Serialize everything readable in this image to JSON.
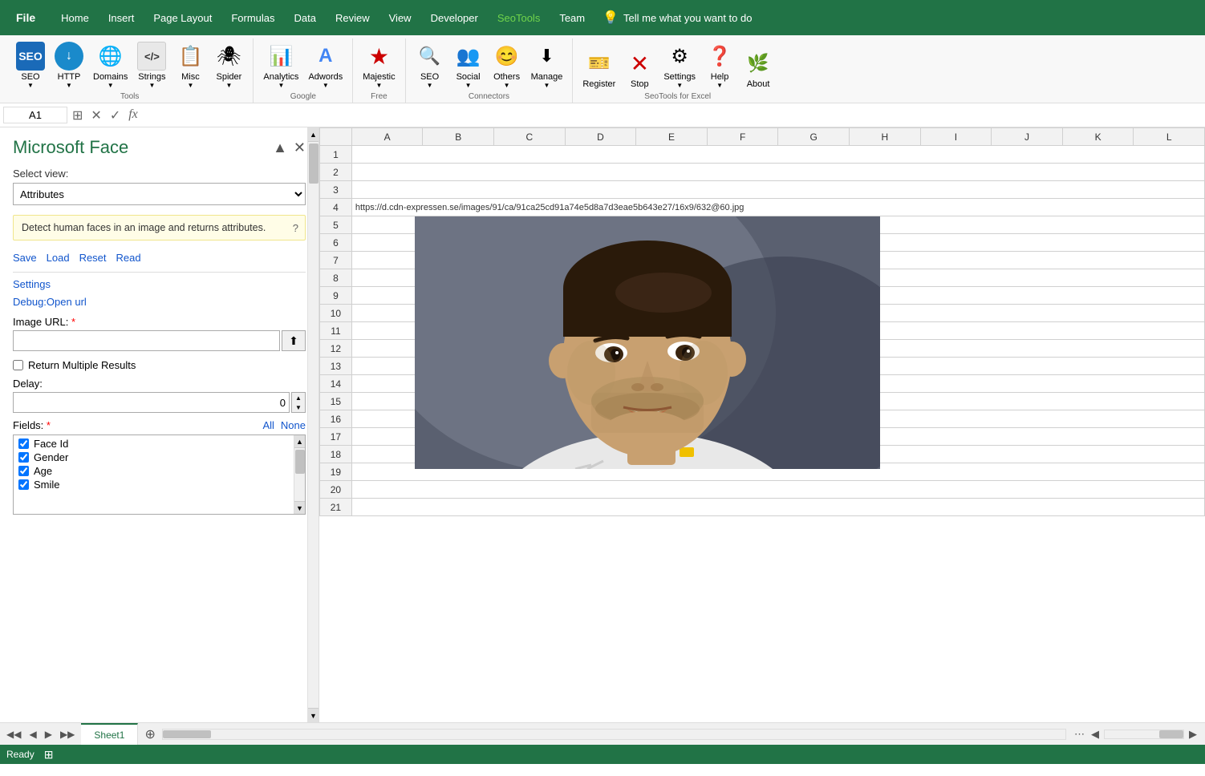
{
  "menubar": {
    "file": "File",
    "items": [
      "Home",
      "Insert",
      "Page Layout",
      "Formulas",
      "Data",
      "Review",
      "View",
      "Developer",
      "SeoTools",
      "Team"
    ],
    "tell": "Tell me what you want to do"
  },
  "ribbon": {
    "groups": {
      "tools": {
        "label": "Tools",
        "items": [
          {
            "id": "seo",
            "icon": "🔍",
            "label": "SEO"
          },
          {
            "id": "http",
            "icon": "↓",
            "label": "HTTP"
          },
          {
            "id": "domains",
            "icon": "🌐",
            "label": "Domains"
          },
          {
            "id": "strings",
            "icon": "</>",
            "label": "Strings"
          },
          {
            "id": "misc",
            "icon": "📋",
            "label": "Misc"
          },
          {
            "id": "spider",
            "icon": "🕷",
            "label": "Spider"
          }
        ]
      },
      "google": {
        "label": "Google",
        "items": [
          {
            "id": "analytics",
            "icon": "📈",
            "label": "Analytics"
          },
          {
            "id": "adwords",
            "icon": "A",
            "label": "Adwords"
          }
        ]
      },
      "free": {
        "label": "Free",
        "items": [
          {
            "id": "majestic",
            "icon": "★",
            "label": "Majestic"
          }
        ]
      },
      "connectors": {
        "label": "Connectors",
        "items": [
          {
            "id": "seo2",
            "icon": "🔍",
            "label": "SEO"
          },
          {
            "id": "social",
            "icon": "👥",
            "label": "Social"
          },
          {
            "id": "others",
            "icon": "😊",
            "label": "Others"
          },
          {
            "id": "manage",
            "icon": "↓",
            "label": "Manage"
          }
        ]
      },
      "seotools": {
        "label": "SeoTools for Excel",
        "items": [
          {
            "id": "register",
            "icon": "🎫",
            "label": "Register"
          },
          {
            "id": "stop",
            "icon": "✖",
            "label": "Stop"
          },
          {
            "id": "settings",
            "icon": "⚙",
            "label": "Settings"
          },
          {
            "id": "help",
            "icon": "❓",
            "label": "Help"
          },
          {
            "id": "about",
            "icon": "🔰",
            "label": "About"
          }
        ]
      }
    }
  },
  "formulabar": {
    "cellref": "A1",
    "value": ""
  },
  "sidebar": {
    "title": "Microsoft Face",
    "select_view_label": "Select view:",
    "select_view_value": "Attributes",
    "info_text": "Detect human faces in an image and returns attributes.",
    "links": {
      "save": "Save",
      "load": "Load",
      "reset": "Reset",
      "read": "Read"
    },
    "settings_link": "Settings",
    "debug_link": "Debug:Open url",
    "image_url_label": "Image URL:",
    "image_url_placeholder": "",
    "return_multiple": "Return Multiple Results",
    "delay_label": "Delay:",
    "delay_value": "0",
    "fields_label": "Fields:",
    "fields_all": "All",
    "fields_none": "None",
    "fields": [
      {
        "name": "Face Id",
        "checked": true
      },
      {
        "name": "Gender",
        "checked": true
      },
      {
        "name": "Age",
        "checked": true
      },
      {
        "name": "Smile",
        "checked": true
      }
    ]
  },
  "spreadsheet": {
    "columns": [
      "A",
      "B",
      "C",
      "D",
      "E",
      "F",
      "G",
      "H",
      "I",
      "J",
      "K",
      "L"
    ],
    "rows": [
      1,
      2,
      3,
      4,
      5,
      6,
      7,
      8,
      9,
      10,
      11,
      12,
      13,
      14,
      15,
      16,
      17,
      18,
      19,
      20,
      21
    ],
    "url_cell": {
      "row": 4,
      "col": "A",
      "value": "https://d.cdn-expressen.se/images/91/ca/91ca25cd91a74e5d8a7d3eae5b643e27/16x9/632@60.jpg"
    }
  },
  "sheet_tabs": {
    "tabs": [
      "Sheet1"
    ],
    "active": "Sheet1"
  },
  "statusbar": {
    "status": "Ready"
  }
}
